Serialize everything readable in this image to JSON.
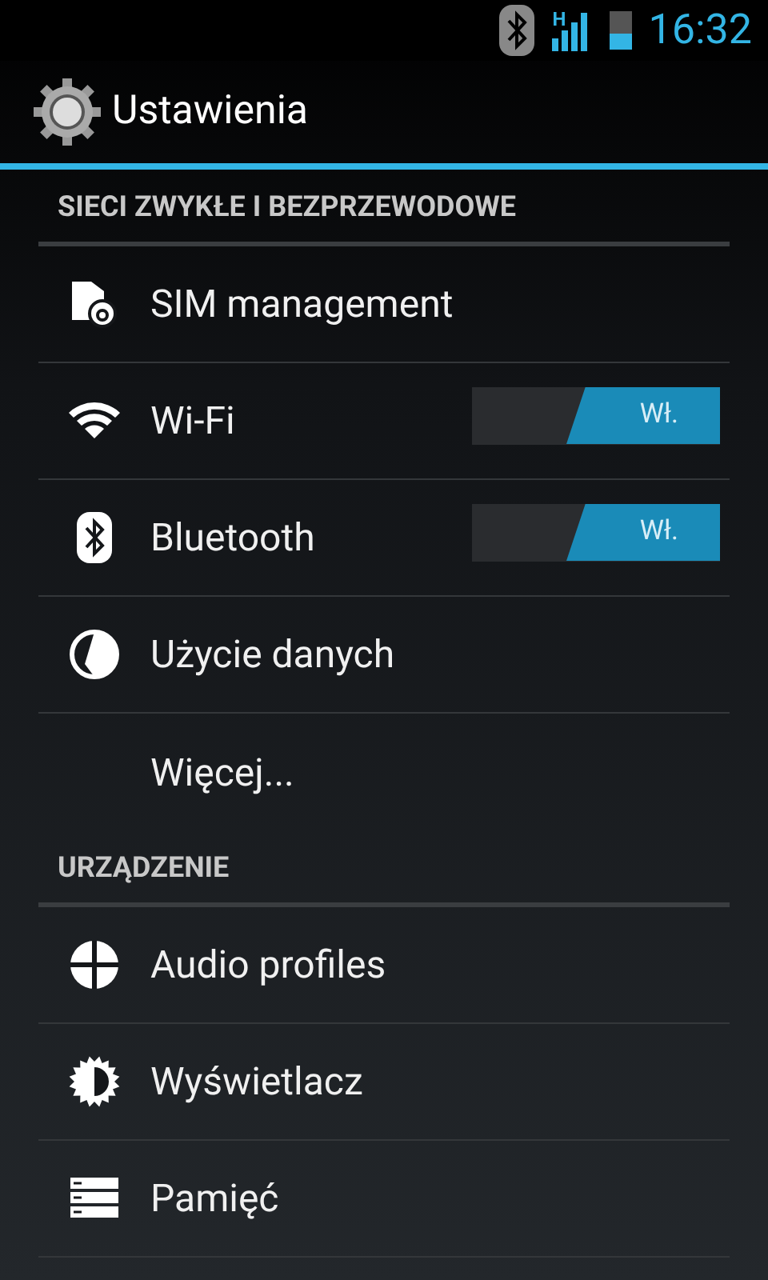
{
  "status_bar": {
    "network_type": "H",
    "time": "16:32"
  },
  "action_bar": {
    "title": "Ustawienia"
  },
  "sections": [
    {
      "header": "SIECI ZWYKŁE I BEZPRZEWODOWE",
      "items": [
        {
          "kind": "plain",
          "label": "SIM management"
        },
        {
          "kind": "switch",
          "label": "Wi-Fi",
          "on": true,
          "switch_label": "Wł."
        },
        {
          "kind": "switch",
          "label": "Bluetooth",
          "on": true,
          "switch_label": "Wł."
        },
        {
          "kind": "plain",
          "label": "Użycie danych"
        },
        {
          "kind": "plain",
          "label": "Więcej..."
        }
      ]
    },
    {
      "header": "URZĄDZENIE",
      "items": [
        {
          "kind": "plain",
          "label": "Audio profiles"
        },
        {
          "kind": "plain",
          "label": "Wyświetlacz"
        },
        {
          "kind": "plain",
          "label": "Pamięć"
        }
      ]
    }
  ]
}
